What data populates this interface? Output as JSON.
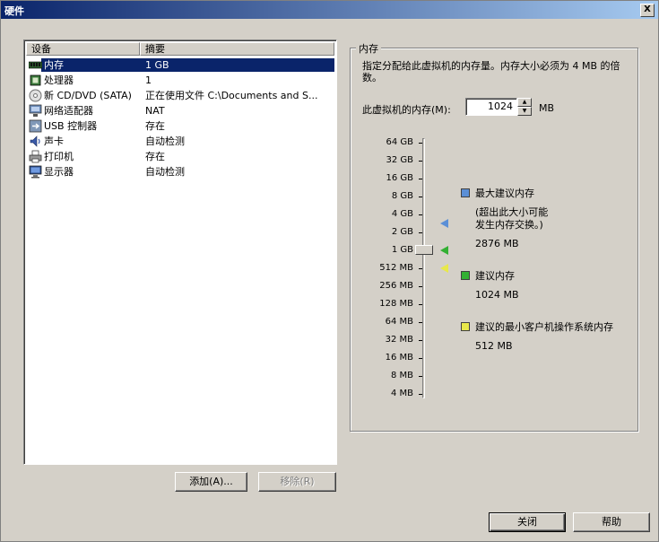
{
  "window": {
    "title": "硬件",
    "close": "X"
  },
  "list": {
    "columns": [
      "设备",
      "摘要"
    ],
    "rows": [
      {
        "name": "内存",
        "summary": "1 GB",
        "icon": "memory-icon",
        "selected": true
      },
      {
        "name": "处理器",
        "summary": "1",
        "icon": "cpu-icon"
      },
      {
        "name": "新 CD/DVD (SATA)",
        "summary": "正在使用文件 C:\\Documents and S...",
        "icon": "cd-dvd-icon"
      },
      {
        "name": "网络适配器",
        "summary": "NAT",
        "icon": "network-adapter-icon"
      },
      {
        "name": "USB 控制器",
        "summary": "存在",
        "icon": "usb-icon"
      },
      {
        "name": "声卡",
        "summary": "自动检测",
        "icon": "sound-card-icon"
      },
      {
        "name": "打印机",
        "summary": "存在",
        "icon": "printer-icon"
      },
      {
        "name": "显示器",
        "summary": "自动检测",
        "icon": "display-icon"
      }
    ]
  },
  "buttons": {
    "add": "添加(A)...",
    "remove": "移除(R)",
    "close": "关闭",
    "help": "帮助"
  },
  "memory": {
    "group_label": "内存",
    "description": "指定分配给此虚拟机的内存量。内存大小必须为 4 MB 的倍数。",
    "field_label": "此虚拟机的内存(M):",
    "value": "1024",
    "unit": "MB",
    "scale": [
      "64 GB",
      "32 GB",
      "16 GB",
      "8 GB",
      "4 GB",
      "2 GB",
      "1 GB",
      "512 MB",
      "256 MB",
      "128 MB",
      "64 MB",
      "32 MB",
      "16 MB",
      "8 MB",
      "4 MB"
    ],
    "legend": {
      "max_title": "最大建议内存",
      "max_note_1": "(超出此大小可能",
      "max_note_2": "发生内存交换。)",
      "max_value": "2876 MB",
      "rec_title": "建议内存",
      "rec_value": "1024 MB",
      "min_title": "建议的最小客户机操作系统内存",
      "min_value": "512 MB"
    },
    "colors": {
      "max": "#5b8fd6",
      "recommended": "#33b033",
      "minimum": "#e8e84a"
    }
  }
}
